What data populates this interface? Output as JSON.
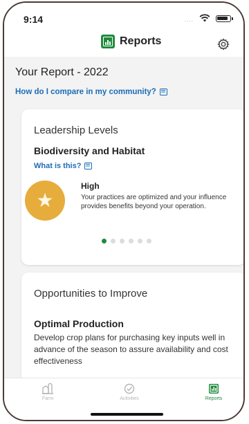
{
  "status_bar": {
    "time": "9:14",
    "signal": "....",
    "icons": [
      "wifi-icon",
      "battery-icon"
    ]
  },
  "header": {
    "title": "Reports",
    "logo_icon": "reports-logo-icon",
    "settings_icon": "gear-icon"
  },
  "report": {
    "year_title": "Your Report - 2022",
    "compare_link": "How do I compare in my community?"
  },
  "leadership_card": {
    "title": "Leadership Levels",
    "category": "Biodiversity and Habitat",
    "what_link": "What is this?",
    "level": "High",
    "level_description": "Your practices are optimized and your influence provides benefits beyond your operation.",
    "badge_icon": "star-icon",
    "pager": {
      "total": 6,
      "active": 1
    }
  },
  "opportunities_card": {
    "title": "Opportunities to Improve",
    "subtitle": "Optimal Production",
    "description": "Develop crop plans for purchasing key inputs well in advance of the season to assure availability and cost effectiveness"
  },
  "tab_bar": {
    "tabs": [
      {
        "label": "Farm",
        "icon": "farm-icon",
        "active": false
      },
      {
        "label": "Activities",
        "icon": "activities-icon",
        "active": false
      },
      {
        "label": "Reports",
        "icon": "reports-icon",
        "active": true
      }
    ]
  },
  "colors": {
    "accent": "#1f8a3b",
    "link": "#1b6db8",
    "badge": "#e6ad3c",
    "background": "#f3f3f3"
  }
}
